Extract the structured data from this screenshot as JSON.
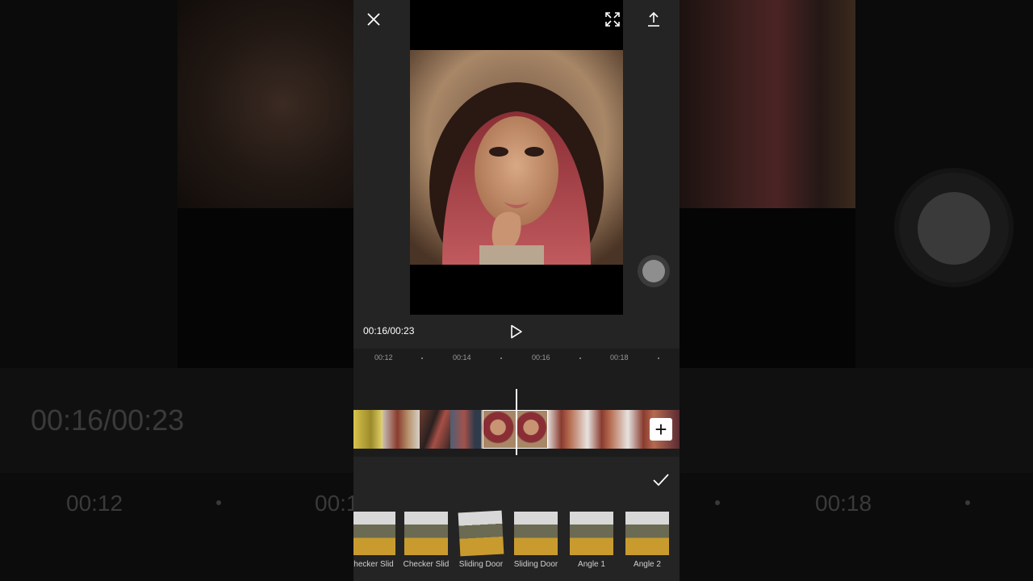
{
  "background": {
    "time_display": "00:16/00:23",
    "ruler_ticks": [
      "00:12",
      "00:1",
      "00:18"
    ]
  },
  "player": {
    "time_display": "00:16/00:23",
    "icons": {
      "close": "close-icon",
      "fullscreen": "fullscreen-icon",
      "export": "export-icon",
      "play": "play-icon"
    }
  },
  "ruler": {
    "ticks": [
      "00:12",
      "00:14",
      "00:16",
      "00:18"
    ]
  },
  "timeline": {
    "playhead_position": "00:16",
    "add_label": "+"
  },
  "transitions": {
    "items": [
      {
        "label": "hecker Slid"
      },
      {
        "label": "Checker Slid"
      },
      {
        "label": "Sliding Door"
      },
      {
        "label": "Sliding Door"
      },
      {
        "label": "Angle 1"
      },
      {
        "label": "Angle 2"
      }
    ]
  },
  "colors": {
    "panel": "#242424",
    "timeline": "#1c1c1c",
    "accent": "#ffffff"
  }
}
